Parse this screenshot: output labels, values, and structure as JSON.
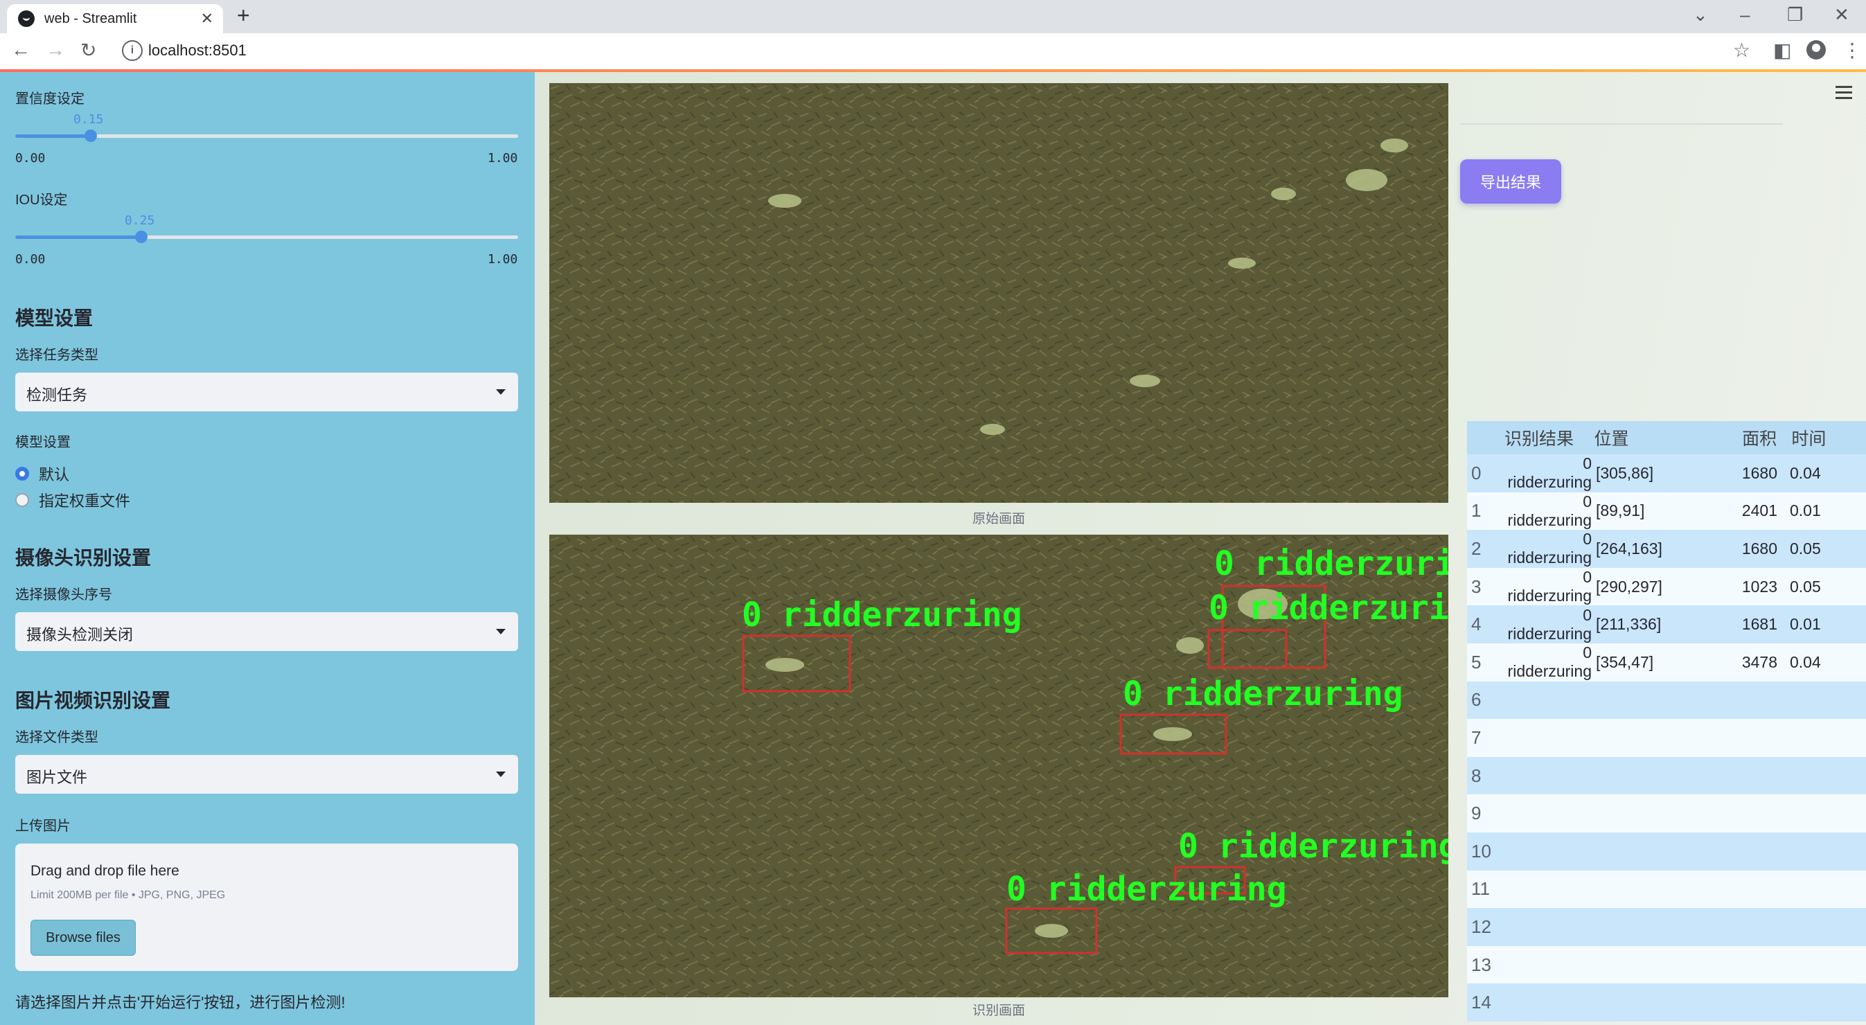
{
  "browser": {
    "tab_title": "web - Streamlit",
    "url": "localhost:8501"
  },
  "sidebar": {
    "confidence": {
      "label": "置信度设定",
      "value": "0.15",
      "value_num": 0.15,
      "min": "0.00",
      "max": "1.00"
    },
    "iou": {
      "label": "IOU设定",
      "value": "0.25",
      "value_num": 0.25,
      "min": "0.00",
      "max": "1.00"
    },
    "model_section": {
      "heading": "模型设置",
      "task_label": "选择任务类型",
      "task_value": "检测任务",
      "model_label": "模型设置",
      "options": [
        {
          "label": "默认",
          "selected": true
        },
        {
          "label": "指定权重文件",
          "selected": false
        }
      ]
    },
    "camera_section": {
      "heading": "摄像头识别设置",
      "label": "选择摄像头序号",
      "value": "摄像头检测关闭"
    },
    "media_section": {
      "heading": "图片视频识别设置",
      "type_label": "选择文件类型",
      "type_value": "图片文件",
      "upload_label": "上传图片",
      "drop_text": "Drag and drop file here",
      "limit_text": "Limit 200MB per file • JPG, PNG, JPEG",
      "browse_label": "Browse files"
    },
    "hint": "请选择图片并点击'开始运行'按钮，进行图片检测!"
  },
  "main": {
    "original_caption": "原始画面",
    "result_caption": "识别画面",
    "export_label": "导出结果",
    "detection_label": "0 ridderzuring",
    "colors": {
      "box": "#d0312d",
      "label": "#22ff22",
      "export": "#8b7cf2",
      "sidebar": "#7ec6dd"
    }
  },
  "table": {
    "headers": [
      "识别结果",
      "位置",
      "面积",
      "时间"
    ],
    "rows": [
      {
        "idx": "0",
        "result": "0 ridderzuring",
        "pos": "[305,86]",
        "area": "1680",
        "time": "0.04"
      },
      {
        "idx": "1",
        "result": "0 ridderzuring",
        "pos": "[89,91]",
        "area": "2401",
        "time": "0.01"
      },
      {
        "idx": "2",
        "result": "0 ridderzuring",
        "pos": "[264,163]",
        "area": "1680",
        "time": "0.05"
      },
      {
        "idx": "3",
        "result": "0 ridderzuring",
        "pos": "[290,297]",
        "area": "1023",
        "time": "0.05"
      },
      {
        "idx": "4",
        "result": "0 ridderzuring",
        "pos": "[211,336]",
        "area": "1681",
        "time": "0.01"
      },
      {
        "idx": "5",
        "result": "0 ridderzuring",
        "pos": "[354,47]",
        "area": "3478",
        "time": "0.04"
      },
      {
        "idx": "6"
      },
      {
        "idx": "7"
      },
      {
        "idx": "8"
      },
      {
        "idx": "9"
      },
      {
        "idx": "10"
      },
      {
        "idx": "11"
      },
      {
        "idx": "12"
      },
      {
        "idx": "13"
      },
      {
        "idx": "14"
      }
    ]
  }
}
